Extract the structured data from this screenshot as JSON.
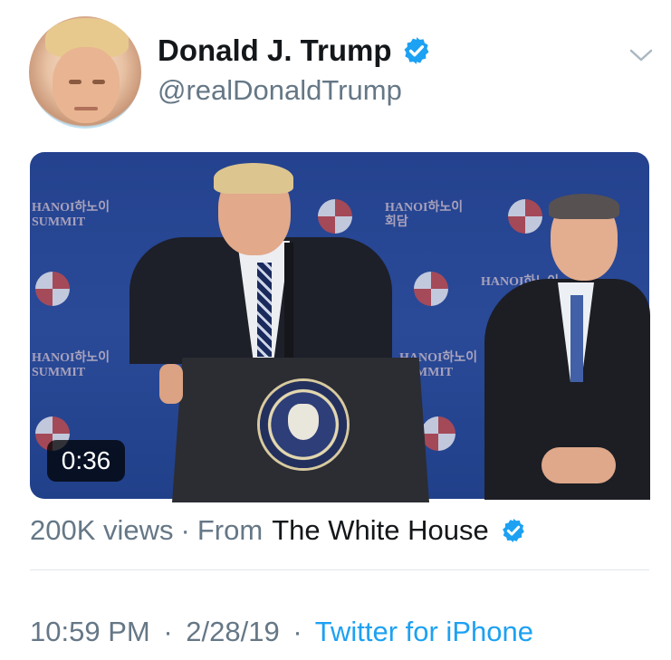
{
  "tweet": {
    "author_name": "Donald J. Trump",
    "author_handle": "@realDonaldTrump",
    "author_verified": true,
    "media": {
      "type": "video",
      "duration": "0:36",
      "backdrop_text": [
        "HANOI하노이",
        "SUMMIT",
        "회담"
      ]
    },
    "views_text": "200K views",
    "separator": "·",
    "from_label": "From",
    "source_name": "The White House",
    "source_verified": true,
    "time": "10:59 PM",
    "date": "2/28/19",
    "client": "Twitter for iPhone"
  },
  "colors": {
    "verified_blue": "#1da1f2",
    "secondary_text": "#657786",
    "primary_text": "#14171a",
    "divider": "#e1e8ed"
  },
  "icons": {
    "verified": "verified-badge-icon",
    "more": "chevron-down-icon"
  }
}
